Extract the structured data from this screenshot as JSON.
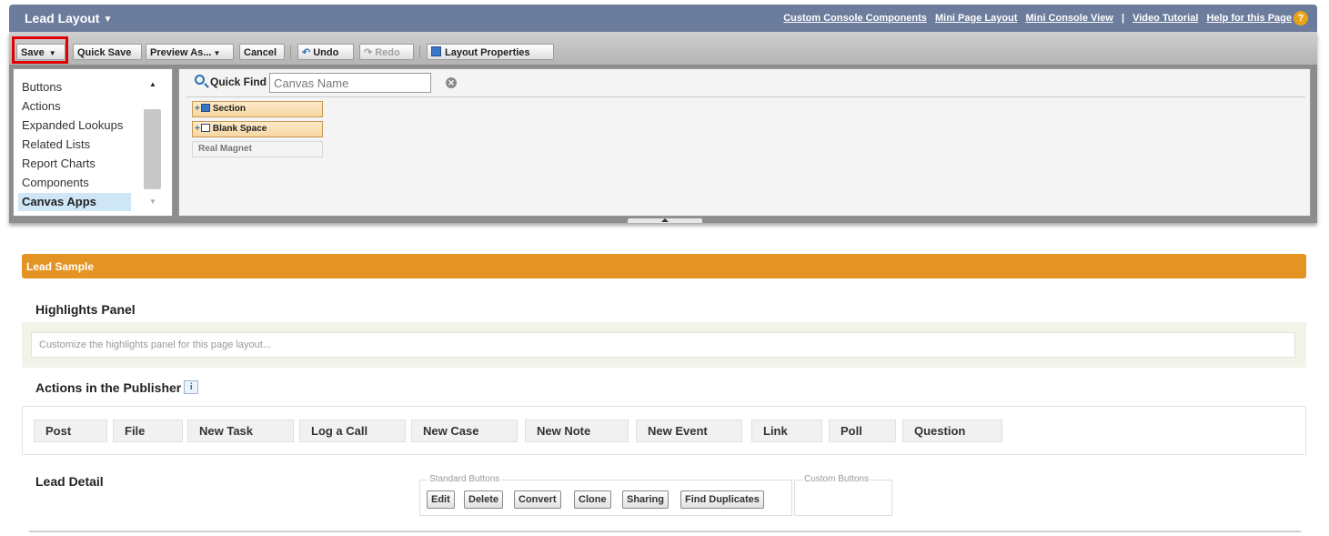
{
  "header": {
    "title": "Lead Layout",
    "links": [
      "Custom Console Components",
      "Mini Page Layout",
      "Mini Console View",
      "Video Tutorial",
      "Help for this Page"
    ],
    "separator": "|",
    "help_icon": "?"
  },
  "toolbar": {
    "save": "Save",
    "quick_save": "Quick Save",
    "preview_as": "Preview As...",
    "cancel": "Cancel",
    "undo": "Undo",
    "redo": "Redo",
    "layout_properties": "Layout Properties"
  },
  "categories": {
    "items": [
      "Buttons",
      "Actions",
      "Expanded Lookups",
      "Related Lists",
      "Report Charts",
      "Components",
      "Canvas Apps"
    ],
    "selected": "Canvas Apps"
  },
  "quick_find": {
    "label": "Quick Find",
    "placeholder": "Canvas Name"
  },
  "palette_items": {
    "section": "Section",
    "blank_space": "Blank Space",
    "real_magnet": "Real Magnet"
  },
  "layout": {
    "sample_title": "Lead Sample",
    "highlights_title": "Highlights Panel",
    "highlights_placeholder": "Customize the highlights panel for this page layout...",
    "publisher_title": "Actions in the Publisher",
    "publisher_actions": [
      "Post",
      "File",
      "New Task",
      "Log a Call",
      "New Case",
      "New Note",
      "New Event",
      "Link",
      "Poll",
      "Question"
    ],
    "detail_title": "Lead Detail",
    "standard_buttons_label": "Standard Buttons",
    "custom_buttons_label": "Custom Buttons",
    "standard_buttons": [
      "Edit",
      "Delete",
      "Convert",
      "Clone",
      "Sharing",
      "Find Duplicates"
    ]
  },
  "colors": {
    "header_bg": "#6c7c9c",
    "sample_bar": "#e39422",
    "highlight_red": "#e00000"
  },
  "icons": [
    "chevron-down-icon",
    "help-icon",
    "undo-icon",
    "redo-icon",
    "layout-properties-icon",
    "search-icon",
    "clear-icon",
    "section-icon",
    "blank-space-icon",
    "info-icon"
  ]
}
